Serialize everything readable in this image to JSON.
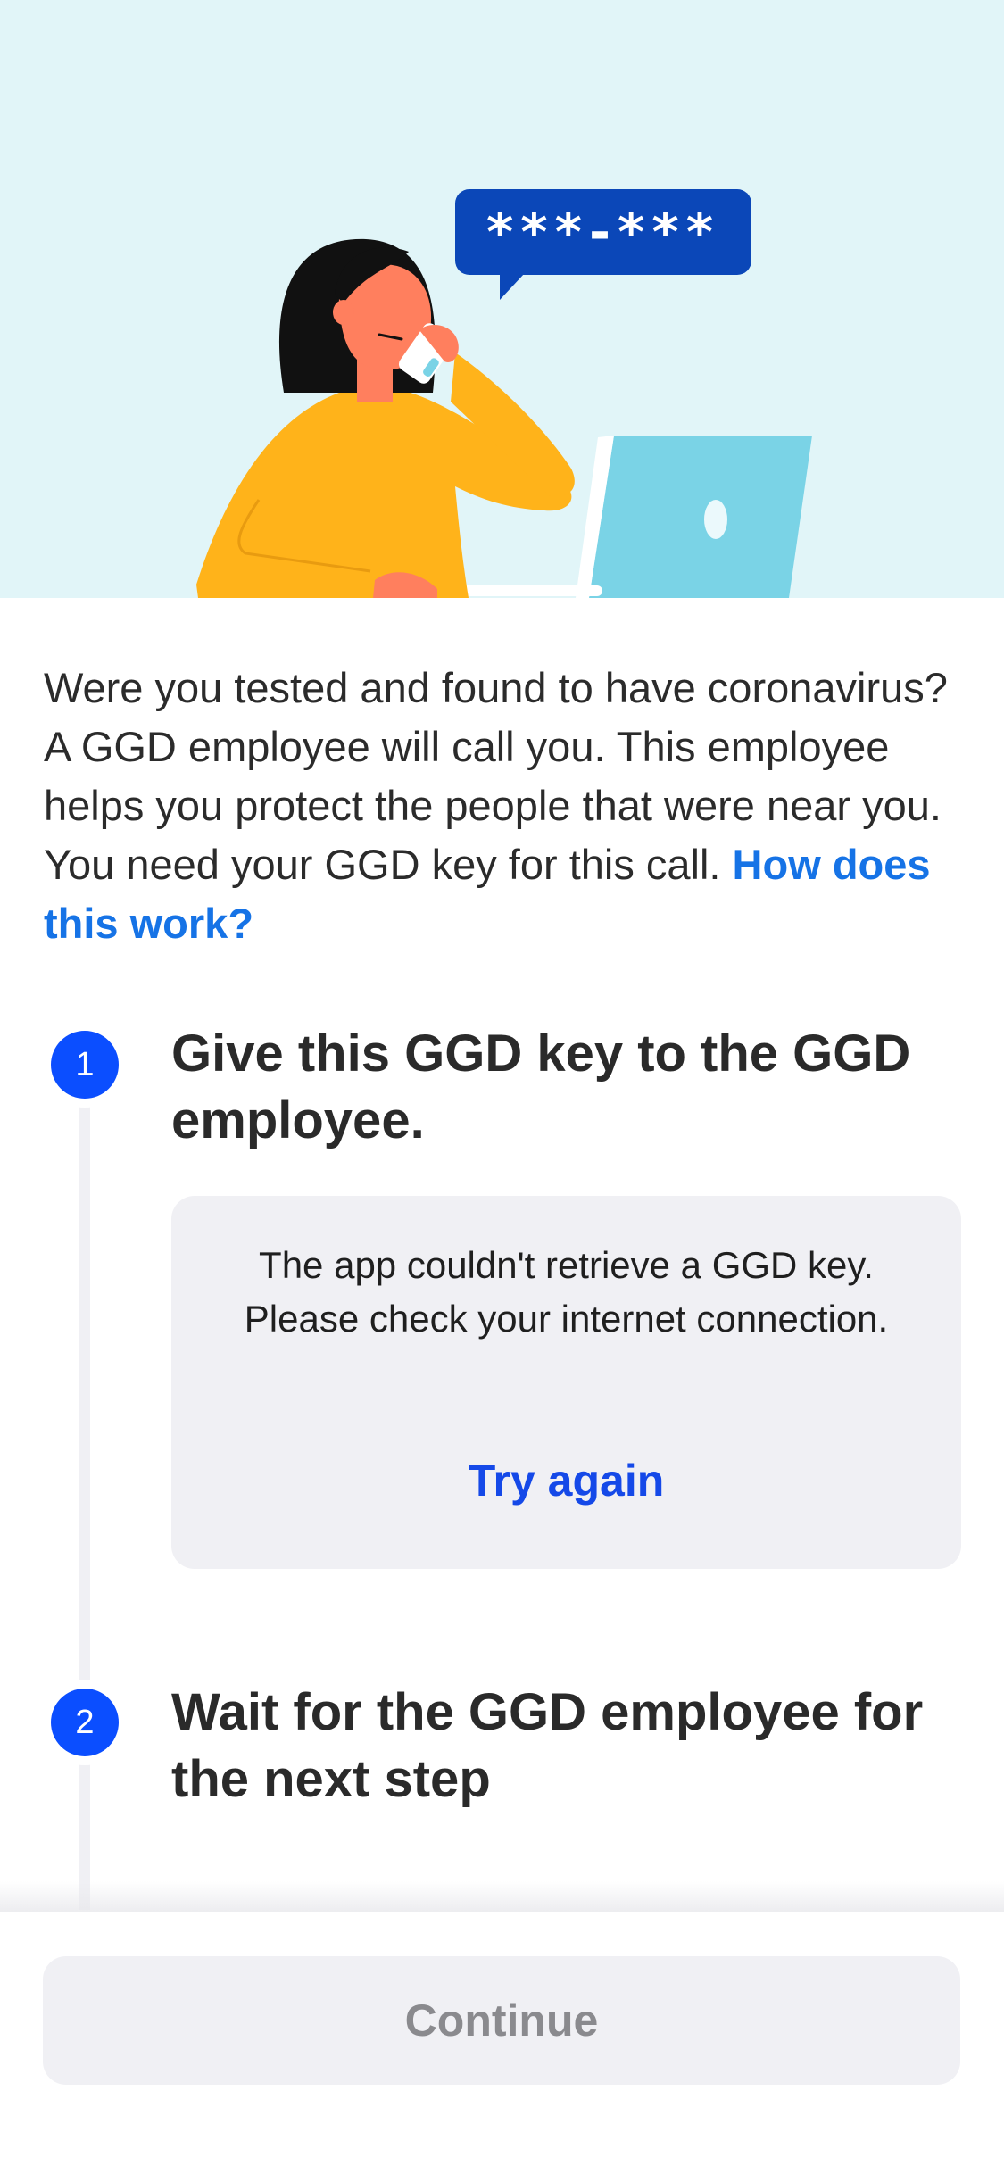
{
  "hero": {
    "speech_bubble_text": "***-***",
    "colors": {
      "background": "#e1f5f8",
      "bubble": "#0b47b8",
      "sweater": "#ffb31a",
      "skin": "#ff7f5e",
      "laptop": "#7ad3e6"
    }
  },
  "intro": {
    "text": "Were you tested and found to have coronavirus? A GGD employee will call you. This employee helps you protect the people that were near you. You need your GGD key for this call.",
    "link_label": "How does this work?"
  },
  "steps": [
    {
      "number": "1",
      "title": "Give this GGD key to the GGD employee."
    },
    {
      "number": "2",
      "title": "Wait for the GGD employee for the next step"
    }
  ],
  "error_card": {
    "message": "The app couldn't retrieve a GGD key. Please check your internet connection.",
    "retry_label": "Try again"
  },
  "footer": {
    "continue_label": "Continue"
  },
  "colors": {
    "accent": "#0b4eff",
    "link": "#1673e6",
    "card_bg": "#f0f0f4",
    "disabled_text": "#8a8a8e"
  }
}
